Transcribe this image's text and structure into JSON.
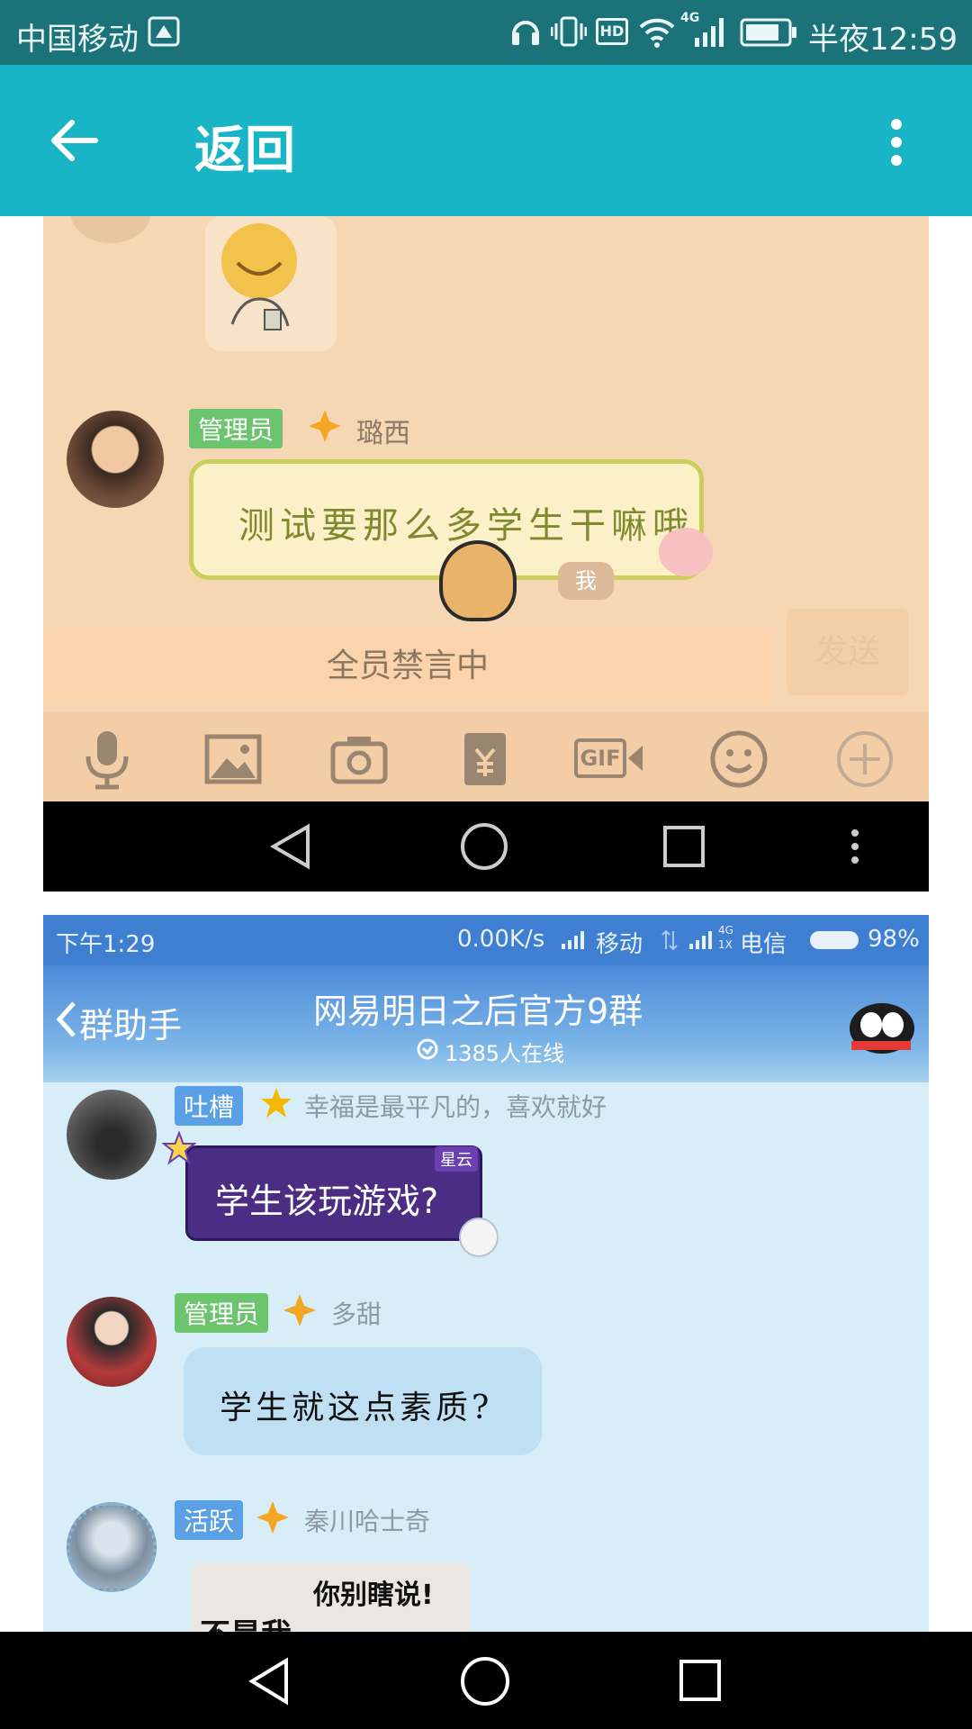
{
  "status_bar": {
    "carrier": "中国移动",
    "hd_label": "HD",
    "net_label": "4G",
    "time": "半夜12:59"
  },
  "app_bar": {
    "title": "返回"
  },
  "shot1": {
    "admin_badge": "管理员",
    "sender_name": "璐西",
    "message": "测试要那么多学生干嘛哦",
    "me_tag": "我",
    "mute_text": "全员禁言中",
    "send_label": "发送",
    "gif_label": "GIF"
  },
  "shot2": {
    "status": {
      "time": "下午1:29",
      "speed": "0.00K/s",
      "carrier1": "移动",
      "carrier2": "电信",
      "battery": "98%",
      "net_label": "4G",
      "net_sub": "1X"
    },
    "header": {
      "back_label": "群助手",
      "group_name": "网易明日之后官方9群",
      "online": "1385人在线"
    },
    "messages": [
      {
        "badge": "吐槽",
        "name": "幸福是最平凡的，喜欢就好",
        "text": "学生该玩游戏?",
        "tag": "星云"
      },
      {
        "badge": "管理员",
        "name": "多甜",
        "text": "学生就这点素质?"
      },
      {
        "badge": "活跃",
        "name": "秦川哈士奇",
        "sticker_line1": "你别瞎说!",
        "sticker_line2": "不是我"
      }
    ]
  },
  "colors": {
    "status_bar": "#1b7379",
    "app_bar": "#19b4c6",
    "shot1_bg": "#f5d7b3",
    "shot2_header": "#3f7fd2",
    "admin_badge": "#6cc46e"
  }
}
